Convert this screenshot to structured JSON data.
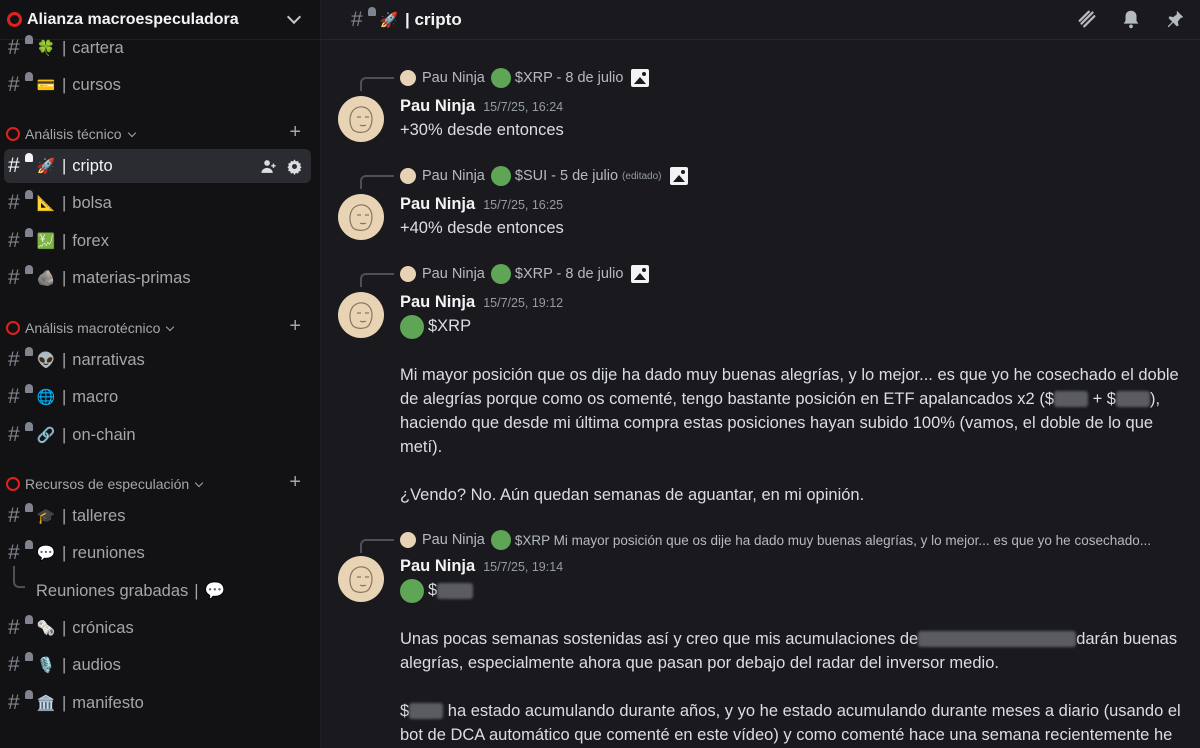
{
  "server": {
    "name": "Alianza macroespeculadora"
  },
  "sidebar": {
    "channels_top": [
      {
        "emoji": "🍀",
        "name": "cartera"
      },
      {
        "emoji": "💳",
        "name": "cursos"
      }
    ],
    "categories": [
      {
        "name": "Análisis técnico",
        "channels": [
          {
            "emoji": "🚀",
            "name": "cripto"
          },
          {
            "emoji": "📐",
            "name": "bolsa"
          },
          {
            "emoji": "💹",
            "name": "forex"
          },
          {
            "emoji": "🪨",
            "name": "materias-primas"
          }
        ]
      },
      {
        "name": "Análisis macrotécnico",
        "channels": [
          {
            "emoji": "👽",
            "name": "narrativas"
          },
          {
            "emoji": "🌐",
            "name": "macro"
          },
          {
            "emoji": "🔗",
            "name": "on-chain"
          }
        ]
      },
      {
        "name": "Recursos de especulación",
        "channels": [
          {
            "emoji": "🎓",
            "name": "talleres"
          },
          {
            "emoji": "💬",
            "name": "reuniones"
          },
          {
            "emoji": "🗞️",
            "name": "crónicas"
          },
          {
            "emoji": "🎙️",
            "name": "audios"
          },
          {
            "emoji": "🏛️",
            "name": "manifesto"
          }
        ]
      }
    ],
    "thread": {
      "name": "Reuniones grabadas",
      "emoji": "💬"
    },
    "separator": "|",
    "hash": "#",
    "plus": "+"
  },
  "header": {
    "emoji": "🚀",
    "title": "| cripto"
  },
  "messages": [
    {
      "reply": {
        "author": "Pau Ninja",
        "text": "$XRP - 8 de julio",
        "edited": ""
      },
      "author": "Pau Ninja",
      "timestamp": "15/7/25, 16:24",
      "text": "+30% desde entonces"
    },
    {
      "reply": {
        "author": "Pau Ninja",
        "text": "$SUI - 5 de julio",
        "edited": "(editado)"
      },
      "author": "Pau Ninja",
      "timestamp": "15/7/25, 16:25",
      "text": "+40% desde entonces"
    },
    {
      "reply": {
        "author": "Pau Ninja",
        "text": "$XRP - 8 de julio",
        "edited": ""
      },
      "author": "Pau Ninja",
      "timestamp": "15/7/25, 19:12",
      "ticker": "$XRP",
      "p1a": "Mi mayor posición que os dije ha dado muy buenas alegrías, y lo mejor... es que yo he cosechado el doble de alegrías porque como os comenté, tengo bastante posición en ETF apalancados x2 ($",
      "p1b": " + $",
      "p1c": "), haciendo que desde mi última compra estas posiciones hayan subido 100% (vamos, el doble de lo que metí).",
      "p2": "¿Vendo? No. Aún quedan semanas de aguantar, en mi opinión."
    },
    {
      "reply": {
        "author": "Pau Ninja",
        "text": "$XRP  Mi mayor posición que os dije ha dado muy buenas alegrías, y lo mejor... es que yo he cosechado...",
        "edited": ""
      },
      "author": "Pau Ninja",
      "timestamp": "15/7/25, 19:14",
      "ticker": "$",
      "p1a": "Unas pocas semanas sostenidas así y creo que mis acumulaciones de",
      "p1b": "darán buenas alegrías, especialmente ahora que pasan por debajo del radar del inversor medio.",
      "p2a": "$",
      "p2b": " ha estado acumulando durante años, y yo he estado acumulando durante meses a diario (usando el bot de DCA automático que comenté en este vídeo) y como comenté hace una semana recientemente he"
    }
  ],
  "colors": {
    "accent_ring": "#e0211f",
    "green_dot": "#5fa556",
    "bg_main": "#1a1a1e",
    "bg_sidebar": "#121214"
  }
}
